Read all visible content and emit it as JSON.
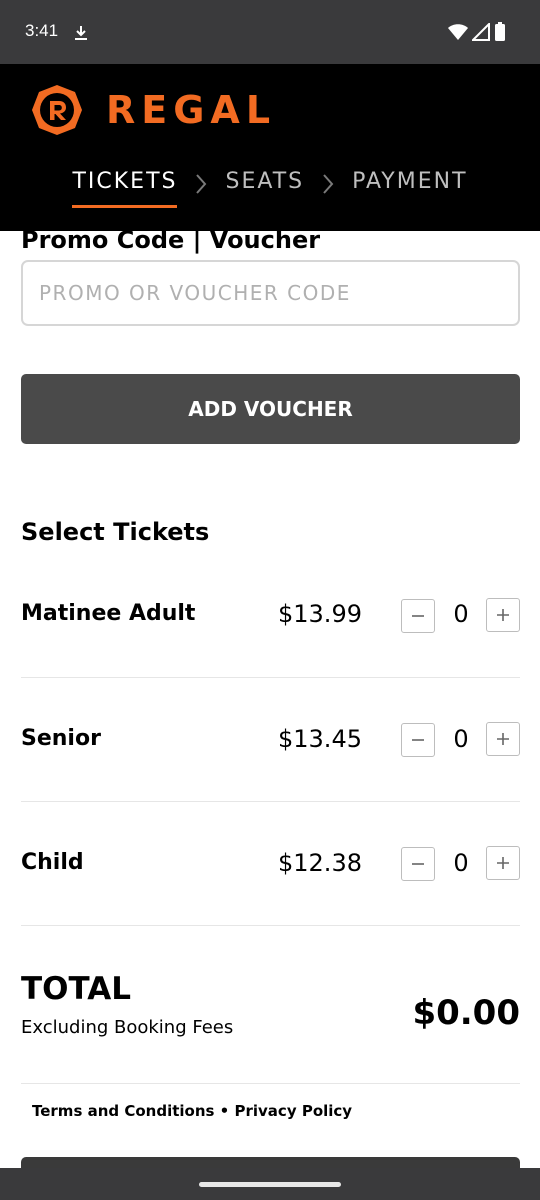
{
  "status": {
    "time": "3:41",
    "icons": [
      "download-icon",
      "wifi-icon",
      "signal-icon",
      "battery-icon"
    ]
  },
  "header": {
    "brand": "REGAL",
    "brand_color": "#f26b22",
    "steps": [
      {
        "label": "TICKETS",
        "active": true
      },
      {
        "label": "SEATS",
        "active": false
      },
      {
        "label": "PAYMENT",
        "active": false
      }
    ]
  },
  "promo": {
    "title": "Promo Code | Voucher",
    "placeholder": "PROMO OR VOUCHER CODE",
    "value": "",
    "button_label": "ADD VOUCHER"
  },
  "tickets": {
    "title": "Select Tickets",
    "items": [
      {
        "name": "Matinee Adult",
        "price": "$13.99",
        "qty": "0"
      },
      {
        "name": "Senior",
        "price": "$13.45",
        "qty": "0"
      },
      {
        "name": "Child",
        "price": "$12.38",
        "qty": "0"
      }
    ]
  },
  "total": {
    "label": "TOTAL",
    "sub": "Excluding Booking Fees",
    "value": "$0.00"
  },
  "legal": {
    "terms": "Terms and Conditions",
    "sep": " • ",
    "privacy": "Privacy Policy"
  }
}
